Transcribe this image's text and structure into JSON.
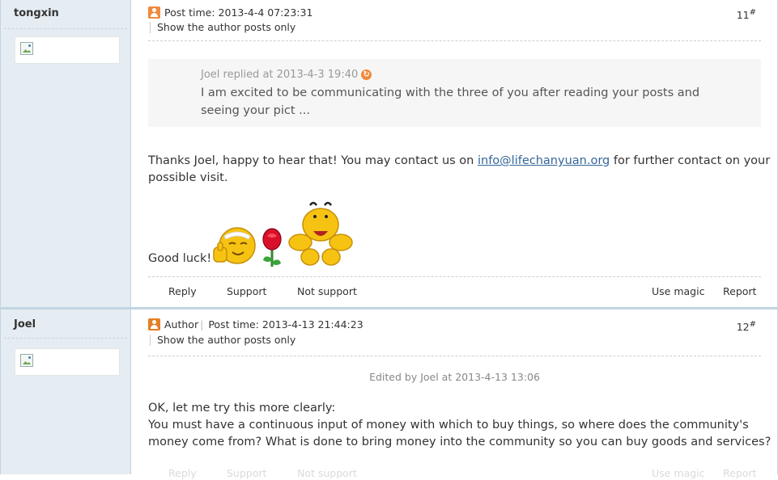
{
  "posts": [
    {
      "author": "tongxin",
      "post_time": "Post time: 2013-4-4 07:23:31",
      "show_author_only": "Show the author posts only",
      "floor_number": "11",
      "floor_mark": "#",
      "quote": {
        "header": "Joel replied at 2013-4-3 19:40",
        "body": "I am excited to be communicating with the three of you after reading your posts and seeing your pict ..."
      },
      "message": {
        "before_link": "Thanks Joel, happy to hear that! You may contact us on ",
        "link": "info@lifechanyuan.org",
        "after_link": " for further contact on your possible visit."
      },
      "closing": "Good luck!",
      "emoticons": [
        "thumbs-up-smiley-icon",
        "rose-icon",
        "bowing-smiley-icon"
      ],
      "actions": {
        "reply": "Reply",
        "support": "Support",
        "not_support": "Not support",
        "use_magic": "Use magic",
        "report": "Report"
      }
    },
    {
      "author": "Joel",
      "author_tag": "Author",
      "post_time": "Post time: 2013-4-13 21:44:23",
      "show_author_only": "Show the author posts only",
      "floor_number": "12",
      "floor_mark": "#",
      "edited_note": "Edited by Joel at 2013-4-13 13:06",
      "body_line1": "OK, let me try this more clearly:",
      "body_line2": "You must have a continuous input of money with which to buy things, so where does the community's money come from? What is done to bring money into the community so you can buy goods and services?",
      "actions": {
        "reply": "Reply",
        "support": "Support",
        "not_support": "Not support",
        "use_magic": "Use magic",
        "report": "Report"
      }
    }
  ],
  "colors": {
    "sidebar_bg": "#e5edf2",
    "border": "#c2d5e3",
    "link": "#336699",
    "icon_orange": "#f08a3b"
  }
}
